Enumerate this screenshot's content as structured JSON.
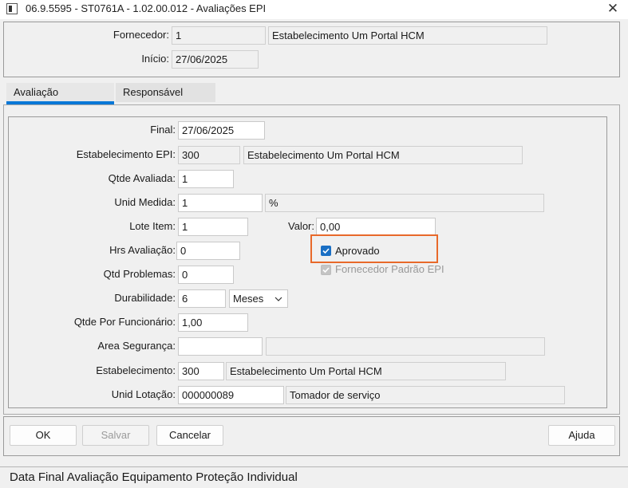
{
  "window": {
    "title": "06.9.5595 - ST0761A - 1.02.00.012 - Avaliações EPI",
    "close_glyph": "✕"
  },
  "header": {
    "fornecedor_label": "Fornecedor:",
    "fornecedor_code": "1",
    "fornecedor_name": "Estabelecimento Um Portal HCM",
    "inicio_label": "Início:",
    "inicio_value": "27/06/2025"
  },
  "tabs": [
    {
      "label": "Avaliação",
      "active": true
    },
    {
      "label": "Responsável",
      "active": false
    }
  ],
  "form": {
    "final_label": "Final:",
    "final_value": "27/06/2025",
    "estab_epi_label": "Estabelecimento EPI:",
    "estab_epi_code": "300",
    "estab_epi_name": "Estabelecimento Um Portal HCM",
    "qtde_avaliada_label": "Qtde Avaliada:",
    "qtde_avaliada_value": "1",
    "unid_medida_label": "Unid Medida:",
    "unid_medida_value": "1",
    "unid_medida_desc": "%",
    "lote_item_label": "Lote Item:",
    "lote_item_value": "1",
    "valor_label": "Valor:",
    "valor_value": "0,00",
    "hrs_avaliacao_label": "Hrs Avaliação:",
    "hrs_avaliacao_value": "0",
    "aprovado_label": "Aprovado",
    "aprovado_checked": true,
    "fornecedor_padrao_label": "Fornecedor Padrão EPI",
    "fornecedor_padrao_checked": true,
    "qtd_problemas_label": "Qtd Problemas:",
    "qtd_problemas_value": "0",
    "durabilidade_label": "Durabilidade:",
    "durabilidade_value": "6",
    "durabilidade_unit": "Meses",
    "qtde_por_func_label": "Qtde Por Funcionário:",
    "qtde_por_func_value": "1,00",
    "area_seguranca_label": "Area Segurança:",
    "area_seguranca_value": "",
    "area_seguranca_desc": "",
    "estabelecimento_label": "Estabelecimento:",
    "estabelecimento_code": "300",
    "estabelecimento_name": "Estabelecimento Um Portal HCM",
    "unid_lotacao_label": "Unid Lotação:",
    "unid_lotacao_code": "000000089",
    "unid_lotacao_name": "Tomador de serviço"
  },
  "buttons": {
    "ok": "OK",
    "salvar": "Salvar",
    "cancelar": "Cancelar",
    "ajuda": "Ajuda"
  },
  "status_bar": {
    "text": "Data Final Avaliação Equipamento Proteção Individual"
  },
  "colors": {
    "accent": "#0a78d7",
    "highlight": "#e8692a",
    "checkbox": "#1a6fc4"
  },
  "icons": {
    "app": "window-app-icon",
    "close": "close-icon",
    "dropdown": "chevron-down-icon",
    "check": "check-icon"
  }
}
